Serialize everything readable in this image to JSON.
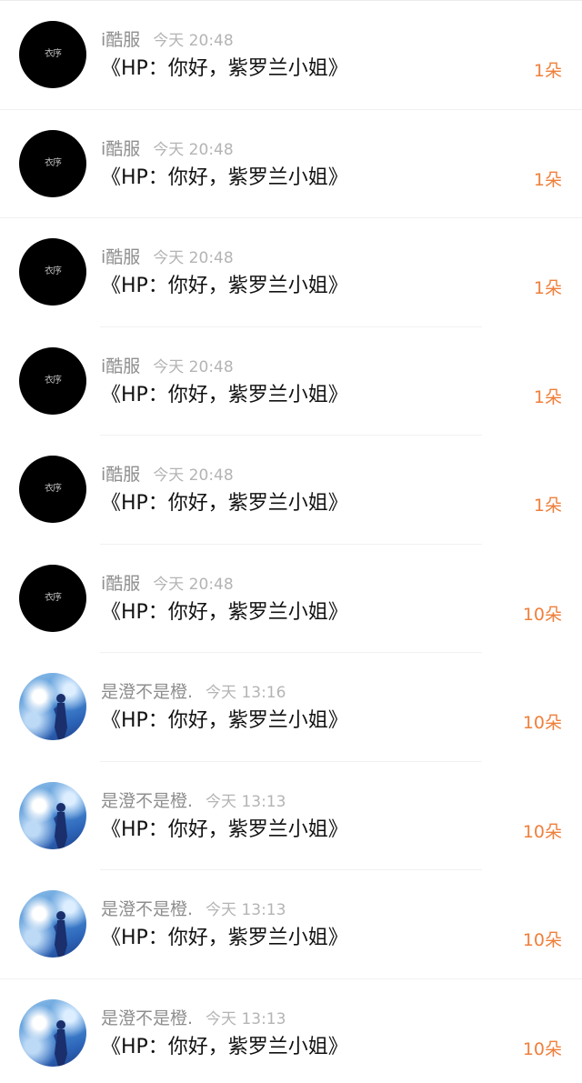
{
  "rows": [
    {
      "avatar": "dark",
      "name": "i酷服",
      "time": "今天 20:48",
      "title": "《HP：你好，紫罗兰小姐》",
      "count": "1朵"
    },
    {
      "avatar": "dark",
      "name": "i酷服",
      "time": "今天 20:48",
      "title": "《HP：你好，紫罗兰小姐》",
      "count": "1朵"
    },
    {
      "avatar": "dark",
      "name": "i酷服",
      "time": "今天 20:48",
      "title": "《HP：你好，紫罗兰小姐》",
      "count": "1朵"
    },
    {
      "avatar": "dark",
      "name": "i酷服",
      "time": "今天 20:48",
      "title": "《HP：你好，紫罗兰小姐》",
      "count": "1朵"
    },
    {
      "avatar": "dark",
      "name": "i酷服",
      "time": "今天 20:48",
      "title": "《HP：你好，紫罗兰小姐》",
      "count": "1朵"
    },
    {
      "avatar": "dark",
      "name": "i酷服",
      "time": "今天 20:48",
      "title": "《HP：你好，紫罗兰小姐》",
      "count": "10朵"
    },
    {
      "avatar": "sky",
      "name": "是澄不是橙.",
      "time": "今天 13:16",
      "title": "《HP：你好，紫罗兰小姐》",
      "count": "10朵"
    },
    {
      "avatar": "sky",
      "name": "是澄不是橙.",
      "time": "今天 13:13",
      "title": "《HP：你好，紫罗兰小姐》",
      "count": "10朵"
    },
    {
      "avatar": "sky",
      "name": "是澄不是橙.",
      "time": "今天 13:13",
      "title": "《HP：你好，紫罗兰小姐》",
      "count": "10朵"
    },
    {
      "avatar": "sky",
      "name": "是澄不是橙.",
      "time": "今天 13:13",
      "title": "《HP：你好，紫罗兰小姐》",
      "count": "10朵"
    }
  ],
  "avatar_mark": "衣序",
  "colors": {
    "count": "#ef7f3b",
    "name": "#8e8e8e",
    "time": "#b4b4b4",
    "title": "#111111"
  }
}
